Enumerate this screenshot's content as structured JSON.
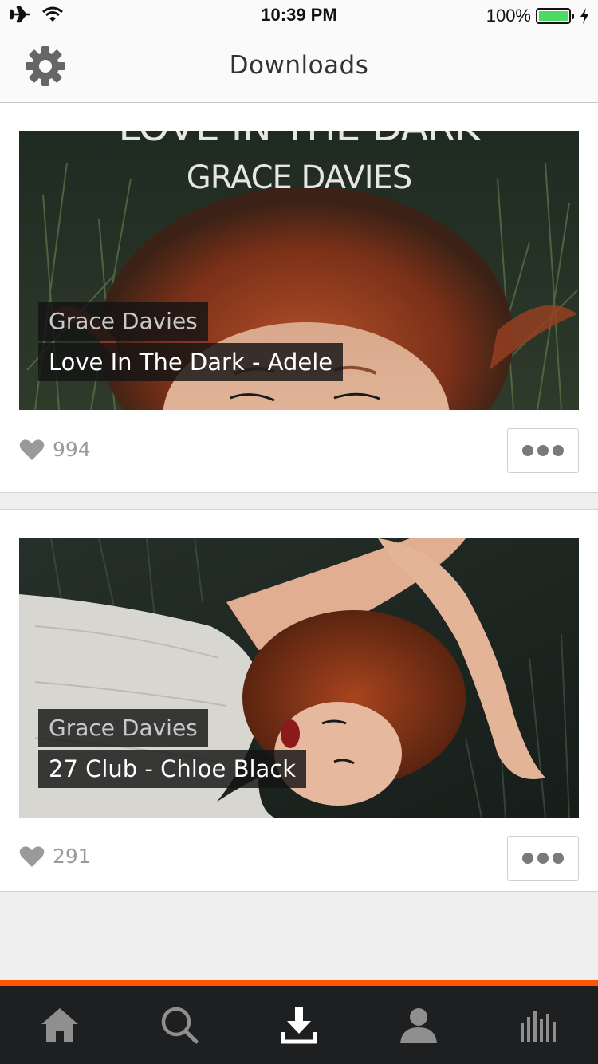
{
  "status_bar": {
    "time": "10:39 PM",
    "battery_text": "100%",
    "battery_level": 1.0,
    "icons": [
      "airplane-icon",
      "wifi-icon",
      "battery-icon",
      "charging-bolt-icon"
    ]
  },
  "header": {
    "title": "Downloads",
    "settings_icon": "gear-icon"
  },
  "tracks": [
    {
      "cover_title": "LOVE IN THE DARK",
      "cover_artist": "GRACE DAVIES",
      "artist": "Grace Davies",
      "title": "Love In The Dark - Adele",
      "likes": "994"
    },
    {
      "artist": "Grace Davies",
      "title": "27 Club - Chloe Black",
      "likes": "291"
    }
  ],
  "tab_bar": {
    "accent_color": "#ff5500",
    "tabs": [
      {
        "icon": "home-icon",
        "active": false
      },
      {
        "icon": "search-icon",
        "active": false
      },
      {
        "icon": "download-icon",
        "active": true
      },
      {
        "icon": "profile-icon",
        "active": false
      },
      {
        "icon": "stream-icon",
        "active": false
      }
    ]
  }
}
